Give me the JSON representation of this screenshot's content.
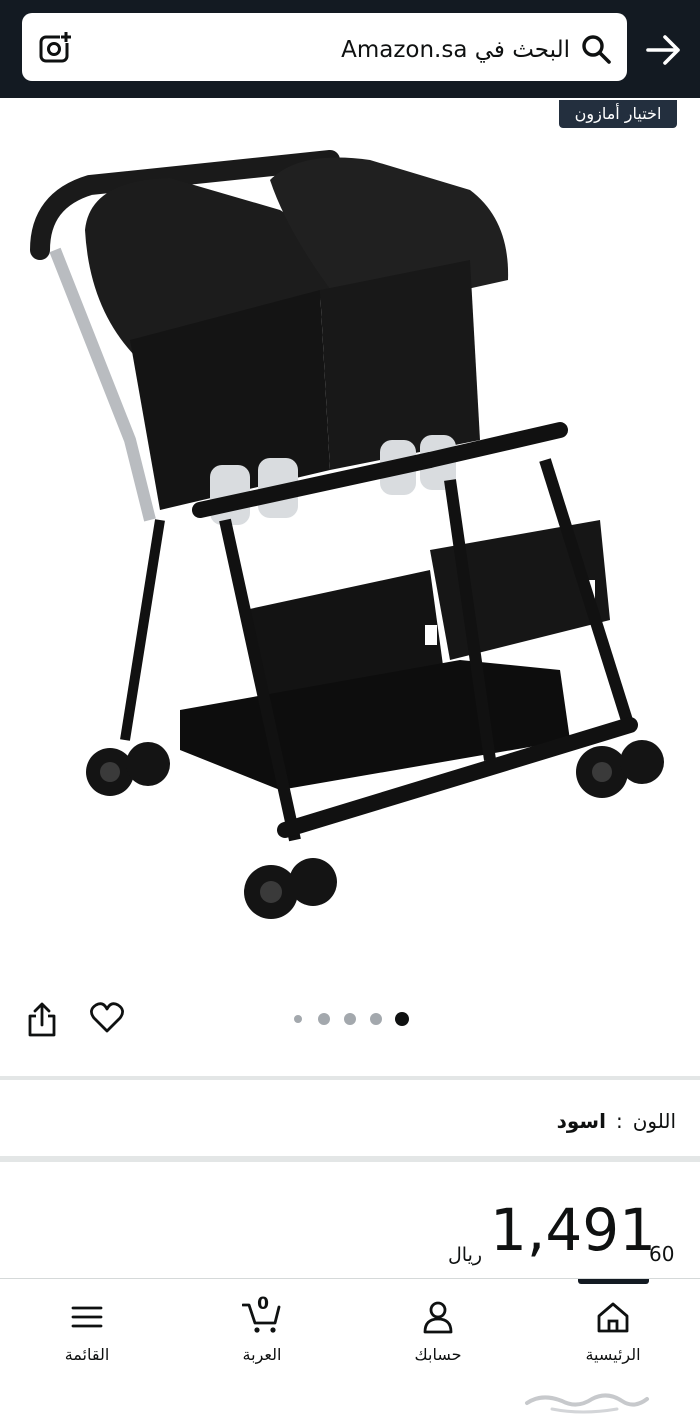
{
  "search": {
    "text": "البحث في Amazon.sa"
  },
  "badge": {
    "label": "اختيار أمازون"
  },
  "product_image": {
    "alt": "عربة أطفال مزدوجة",
    "icon": "stroller-image"
  },
  "carousel": {
    "total": 5,
    "active": 4
  },
  "actions": {
    "share_icon": "share-icon",
    "wishlist_icon": "heart-icon"
  },
  "variant": {
    "label": "اللون",
    "separator": ":",
    "value": "اسود"
  },
  "price": {
    "currency": "ريال",
    "whole": "1,491",
    "fraction": "60"
  },
  "nav": {
    "active": "home",
    "items": [
      {
        "id": "home",
        "label": "الرئيسية",
        "icon": "home-icon"
      },
      {
        "id": "account",
        "label": "حسابك",
        "icon": "user-icon"
      },
      {
        "id": "cart",
        "label": "العربة",
        "icon": "cart-icon",
        "count": "0"
      },
      {
        "id": "menu",
        "label": "القائمة",
        "icon": "menu-icon"
      }
    ]
  },
  "watermark": {
    "text": "حراج"
  },
  "colors": {
    "header": "#131a22",
    "badge": "#232f3e",
    "divider": "#e3e6e6"
  }
}
